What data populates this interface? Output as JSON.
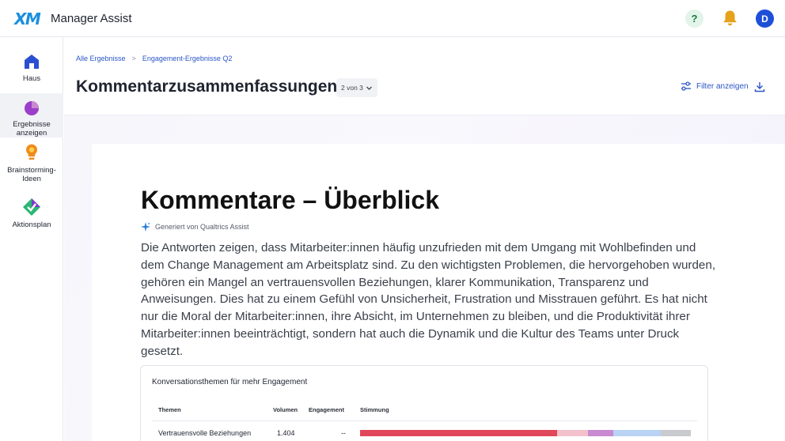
{
  "header": {
    "logo_text": "XM",
    "app_title": "Manager Assist",
    "help_label": "?",
    "avatar_initial": "D"
  },
  "sidebar": {
    "items": [
      {
        "label": "Haus",
        "icon": "home-icon"
      },
      {
        "label": "Ergebnisse anzeigen",
        "icon": "pie-chart-icon",
        "active": true
      },
      {
        "label": "Brainstorming-Ideen",
        "icon": "lightbulb-icon"
      },
      {
        "label": "Aktionsplan",
        "icon": "action-plan-icon"
      }
    ]
  },
  "breadcrumb": {
    "items": [
      "Alle Ergebnisse",
      "Engagement-Ergebnisse Q2"
    ],
    "separator": ">"
  },
  "page": {
    "title": "Kommentarzusammenfassungen",
    "page_select": "2 von 3",
    "filter_label": "Filter anzeigen"
  },
  "summary": {
    "title": "Kommentare – Überblick",
    "generated_by": "Generiert von Qualtrics Assist",
    "text": "Die Antworten zeigen, dass Mitarbeiter:innen häufig unzufrieden mit dem Umgang mit Wohlbefinden und dem Change Management am Arbeitsplatz sind. Zu den wichtigsten Problemen, die hervorgehoben wurden, gehören ein Mangel an vertrauensvollen Beziehungen, klarer Kommunikation, Transparenz und Anweisungen. Dies hat zu einem Gefühl von Unsicherheit, Frustration und Misstrauen geführt. Es hat nicht nur die Moral der Mitarbeiter:innen, ihre Absicht, im Unternehmen zu bleiben, und die Produktivität ihrer Mitarbeiter:innen beeinträchtigt, sondern hat auch die Dynamik und die Kultur des Teams unter Druck gesetzt."
  },
  "themes_table": {
    "title": "Konversationsthemen für mehr Engagement",
    "columns": [
      "Themen",
      "Volumen",
      "Engagement",
      "Stimmung"
    ],
    "rows": [
      {
        "theme": "Vertrauensvolle Beziehungen",
        "volume": "1.404",
        "engagement": "--",
        "sentiment": [
          {
            "share": 0.595,
            "color": "#e0475b"
          },
          {
            "share": 0.095,
            "color": "#f3c1cc"
          },
          {
            "share": 0.075,
            "color": "#c98ad2"
          },
          {
            "share": 0.145,
            "color": "#b9d3f5"
          },
          {
            "share": 0.09,
            "color": "#c9cace"
          }
        ]
      }
    ]
  },
  "colors": {
    "accent": "#2a56c6",
    "logo": "#1a8fe0",
    "bell": "#e5a21a",
    "avatar": "#1d4fd8"
  }
}
